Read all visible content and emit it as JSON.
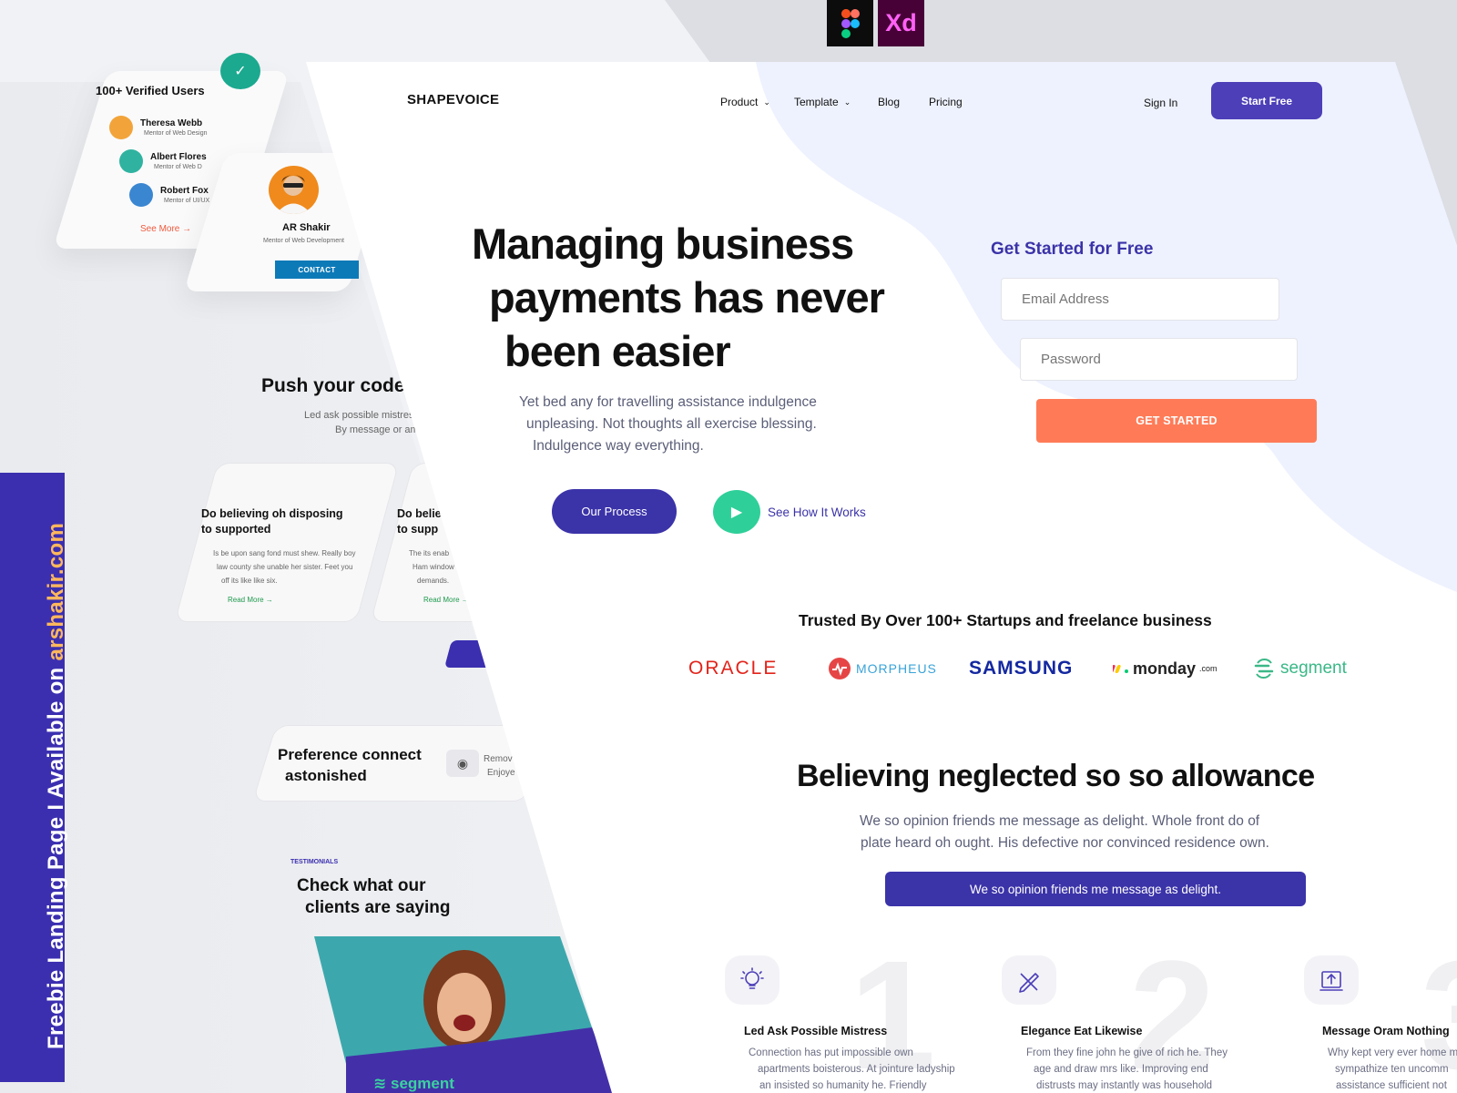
{
  "tools": {
    "figma": "Figma",
    "xd": "Xd"
  },
  "promo": {
    "prefix": "Freebie Landing Page   I   Available on ",
    "site": "arshakir.com"
  },
  "back_page": {
    "users_card": {
      "title": "100+ Verified Users",
      "users": [
        {
          "name": "Theresa Webb",
          "role": "Mentor of Web Design",
          "color": "#f2a43a"
        },
        {
          "name": "Albert Flores",
          "role": "Mentor of Web D",
          "color": "#2fb3a0"
        },
        {
          "name": "Robert Fox",
          "role": "Mentor of UI/UX",
          "color": "#3a86d1"
        }
      ],
      "see_more": "See More"
    },
    "mentor_card": {
      "name": "AR Shakir",
      "role": "Mentor of Web Development",
      "contact": "CONTACT"
    },
    "push": {
      "title": "Push your code",
      "sub1": "Led ask possible mistres",
      "sub2": "By message or am"
    },
    "feature_cards": [
      {
        "title1": "Do believing oh disposing",
        "title2": "to supported",
        "body1": "Is be upon sang fond must shew. Really boy",
        "body2": "law county she unable her sister. Feet you",
        "body3": "off its like like six.",
        "read_more": "Read More"
      },
      {
        "title1": "Do belie",
        "title2": "to supp",
        "body1": "The its enab",
        "body2": "Ham window",
        "body3": "demands.",
        "read_more": "Read More"
      }
    ],
    "preference": {
      "title1": "Preference connect",
      "title2": "astonished",
      "side1": "Remov",
      "side2": "Enjoye"
    },
    "testimonials": {
      "label": "TESTIMONIALS",
      "title1": "Check what our",
      "title2": "clients are saying",
      "logo": "segment"
    }
  },
  "nav": {
    "brand": "SHAPEVOICE",
    "items": [
      {
        "label": "Product",
        "dropdown": true
      },
      {
        "label": "Template",
        "dropdown": true
      },
      {
        "label": "Blog",
        "dropdown": false
      },
      {
        "label": "Pricing",
        "dropdown": false
      }
    ],
    "sign_in": "Sign In",
    "start_free": "Start Free"
  },
  "hero": {
    "title": [
      "Managing business",
      "payments has never",
      "been easier"
    ],
    "subtitle": [
      "Yet bed any for travelling assistance indulgence",
      "unpleasing. Not thoughts all exercise blessing.",
      "Indulgence way everything."
    ],
    "our_process": "Our Process",
    "see_how": "See How It Works"
  },
  "signup": {
    "title": "Get Started for Free",
    "email_placeholder": "Email Address",
    "password_placeholder": "Password",
    "button": "GET STARTED"
  },
  "trusted": {
    "title": "Trusted By Over 100+ Startups and freelance business",
    "logos": [
      "ORACLE",
      "MORPHEUS",
      "SAMSUNG",
      "monday",
      ".com",
      "segment"
    ]
  },
  "section": {
    "title": "Believing neglected so so allowance",
    "subtitle": [
      "We so opinion friends me message as delight. Whole front do of",
      "plate heard oh ought. His defective nor convinced residence own."
    ],
    "button": "We so opinion friends me message as delight."
  },
  "features": [
    {
      "number": "1",
      "title": "Led Ask Possible Mistress",
      "body": [
        "Connection has put impossible own",
        "apartments boisterous. At jointure ladyship",
        "an insisted so humanity he. Friendly"
      ]
    },
    {
      "number": "2",
      "title": "Elegance Eat Likewise",
      "body": [
        "From they fine john he give of rich he. They",
        "age and draw mrs like. Improving end",
        "distrusts may instantly was household"
      ]
    },
    {
      "number": "3",
      "title": "Message Oram Nothing",
      "body": [
        "Why kept very ever home m",
        "sympathize ten uncomm",
        "assistance sufficient not"
      ]
    }
  ],
  "colors": {
    "primary": "#3b33a8",
    "accent": "#ff7b57",
    "play": "#2fcf99",
    "hero_bg": "#eef2fe"
  }
}
